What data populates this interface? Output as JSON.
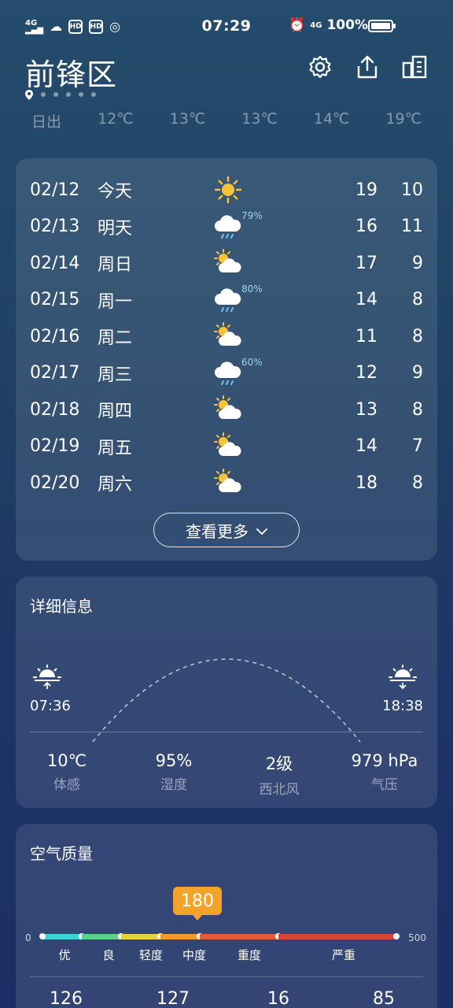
{
  "status_bar": {
    "time": "07:29",
    "battery": "100%",
    "network": "4G",
    "signal_icons": [
      "4g-signal-icon",
      "cloud-icon",
      "hd-icon",
      "hd-icon",
      "circle-icon"
    ],
    "right_icons": [
      "alarm-icon",
      "4g-icon"
    ]
  },
  "header": {
    "city": "前锋区",
    "actions": [
      "settings-icon",
      "share-icon",
      "city-list-icon"
    ]
  },
  "hourly": [
    "日出",
    "12℃",
    "13℃",
    "13℃",
    "14℃",
    "19℃"
  ],
  "forecast": {
    "rows": [
      {
        "date": "02/12",
        "day": "今天",
        "icon": "sunny-icon",
        "pop": "",
        "high": "19",
        "low": "10"
      },
      {
        "date": "02/13",
        "day": "明天",
        "icon": "rain-icon",
        "pop": "79%",
        "high": "16",
        "low": "11"
      },
      {
        "date": "02/14",
        "day": "周日",
        "icon": "partly-cloudy-icon",
        "pop": "",
        "high": "17",
        "low": "9"
      },
      {
        "date": "02/15",
        "day": "周一",
        "icon": "rain-icon",
        "pop": "80%",
        "high": "14",
        "low": "8"
      },
      {
        "date": "02/16",
        "day": "周二",
        "icon": "partly-cloudy-icon",
        "pop": "",
        "high": "11",
        "low": "8"
      },
      {
        "date": "02/17",
        "day": "周三",
        "icon": "rain-icon",
        "pop": "60%",
        "high": "12",
        "low": "9"
      },
      {
        "date": "02/18",
        "day": "周四",
        "icon": "partly-cloudy-icon",
        "pop": "",
        "high": "13",
        "low": "8"
      },
      {
        "date": "02/19",
        "day": "周五",
        "icon": "partly-cloudy-icon",
        "pop": "",
        "high": "14",
        "low": "7"
      },
      {
        "date": "02/20",
        "day": "周六",
        "icon": "partly-cloudy-icon",
        "pop": "",
        "high": "18",
        "low": "8"
      }
    ],
    "more_label": "查看更多"
  },
  "details": {
    "title": "详细信息",
    "sunrise": "07:36",
    "sunset": "18:38",
    "stats": [
      {
        "value": "10℃",
        "label": "体感"
      },
      {
        "value": "95%",
        "label": "湿度"
      },
      {
        "value": "2级",
        "label": "西北风"
      },
      {
        "value": "979 hPa",
        "label": "气压"
      }
    ]
  },
  "aqi": {
    "title": "空气质量",
    "value": "180",
    "min": "0",
    "max": "500",
    "levels": [
      "优",
      "良",
      "轻度",
      "中度",
      "重度",
      "严重"
    ],
    "colors": [
      "#3dd3d3",
      "#5ccf8c",
      "#e6d23c",
      "#f39a2a",
      "#e55a3a",
      "#d9443a"
    ],
    "pollutants_partial": [
      "126",
      "127",
      "16",
      "85"
    ]
  }
}
